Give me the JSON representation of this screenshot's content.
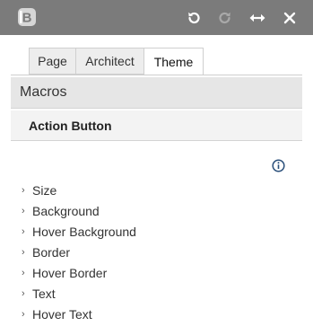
{
  "toolbar": {
    "logo_icon": "b-logo-icon",
    "buttons": [
      {
        "name": "undo-button",
        "icon": "undo-icon"
      },
      {
        "name": "redo-button",
        "icon": "redo-icon"
      },
      {
        "name": "expand-width-button",
        "icon": "arrows-horizontal-icon"
      },
      {
        "name": "close-button",
        "icon": "close-icon"
      }
    ]
  },
  "tabs": [
    {
      "label": "Page",
      "active": false
    },
    {
      "label": "Architect",
      "active": false
    },
    {
      "label": "Theme",
      "active": true
    }
  ],
  "section": {
    "title": "Macros",
    "subtitle": "Action Button"
  },
  "properties": [
    {
      "label": "Size"
    },
    {
      "label": "Background"
    },
    {
      "label": "Hover Background"
    },
    {
      "label": "Border"
    },
    {
      "label": "Hover Border"
    },
    {
      "label": "Text"
    },
    {
      "label": "Hover Text"
    }
  ],
  "colors": {
    "toolbar_bg": "#7b7b7b",
    "macros_bg": "#e6e6e6",
    "action_bg": "#f3f3f3",
    "info_accent": "#2a4f7a"
  }
}
